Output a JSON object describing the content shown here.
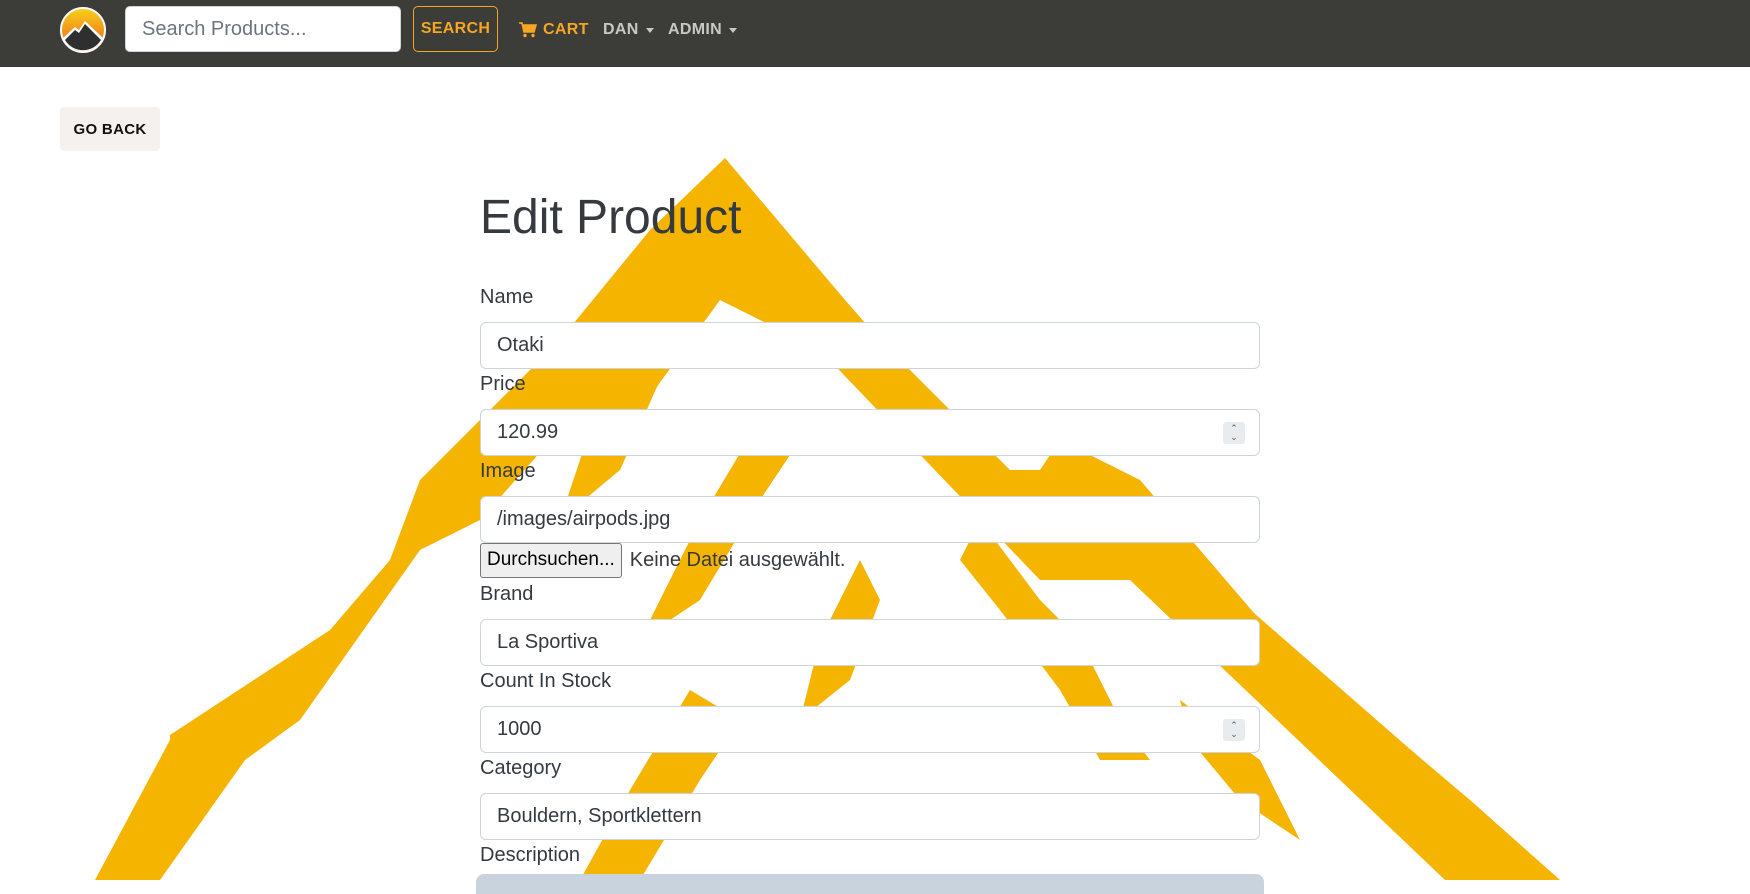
{
  "colors": {
    "navbar_bg": "#3c3c38",
    "accent": "#f5a623",
    "watermark": "#f5b400"
  },
  "navbar": {
    "logo_icon": "mountain-sun-logo-icon",
    "search": {
      "placeholder": "Search Products...",
      "value": ""
    },
    "search_button": "SEARCH",
    "cart_icon": "shopping-cart-icon",
    "cart_label": "CART",
    "user_menu": "DAN",
    "admin_menu": "ADMIN"
  },
  "go_back_label": "GO BACK",
  "form": {
    "title": "Edit Product",
    "name": {
      "label": "Name",
      "value": "Otaki"
    },
    "price": {
      "label": "Price",
      "value": "120.99"
    },
    "image": {
      "label": "Image",
      "value": "/images/airpods.jpg",
      "file_button": "Durchsuchen...",
      "file_status": "Keine Datei ausgewählt."
    },
    "brand": {
      "label": "Brand",
      "value": "La Sportiva"
    },
    "count_in_stock": {
      "label": "Count In Stock",
      "value": "1000"
    },
    "category": {
      "label": "Category",
      "value": "Bouldern, Sportklettern"
    },
    "description": {
      "label": "Description",
      "value": ""
    }
  }
}
